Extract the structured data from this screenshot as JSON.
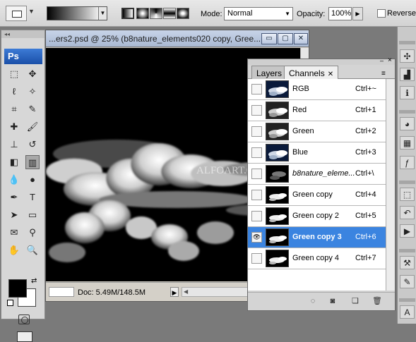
{
  "options_bar": {
    "mode_label": "Mode:",
    "mode_value": "Normal",
    "opacity_label": "Opacity:",
    "opacity_value": "100%",
    "reverse_label": "Reverse",
    "reverse_checked": false
  },
  "toolbox": {
    "logo": "Ps",
    "tools": [
      {
        "name": "marquee-tool-icon",
        "glyph": "⬚"
      },
      {
        "name": "move-tool-icon",
        "glyph": "✥"
      },
      {
        "name": "lasso-tool-icon",
        "glyph": "ℓ"
      },
      {
        "name": "magic-wand-tool-icon",
        "glyph": "✧"
      },
      {
        "name": "crop-tool-icon",
        "glyph": "⌗"
      },
      {
        "name": "slice-tool-icon",
        "glyph": "✎"
      },
      {
        "name": "healing-brush-tool-icon",
        "glyph": "✚"
      },
      {
        "name": "brush-tool-icon",
        "glyph": "🖌"
      },
      {
        "name": "clone-stamp-tool-icon",
        "glyph": "⊥"
      },
      {
        "name": "history-brush-tool-icon",
        "glyph": "↺"
      },
      {
        "name": "eraser-tool-icon",
        "glyph": "◧"
      },
      {
        "name": "gradient-tool-icon",
        "glyph": "▥"
      },
      {
        "name": "blur-tool-icon",
        "glyph": "💧"
      },
      {
        "name": "dodge-tool-icon",
        "glyph": "●"
      },
      {
        "name": "pen-tool-icon",
        "glyph": "✒"
      },
      {
        "name": "type-tool-icon",
        "glyph": "T"
      },
      {
        "name": "path-selection-tool-icon",
        "glyph": "➤"
      },
      {
        "name": "shape-tool-icon",
        "glyph": "▭"
      },
      {
        "name": "notes-tool-icon",
        "glyph": "✉"
      },
      {
        "name": "eyedropper-tool-icon",
        "glyph": "⚲"
      },
      {
        "name": "hand-tool-icon",
        "glyph": "✋"
      },
      {
        "name": "zoom-tool-icon",
        "glyph": "🔍"
      }
    ],
    "selected_tool": "gradient-tool-icon",
    "foreground_color": "#000000",
    "background_color": "#ffffff"
  },
  "document": {
    "title": "...ers2.psd @ 25% (b8nature_elements020 copy, Gree...",
    "watermark": "ALFOART.COM",
    "status": "Doc: 5.49M/148.5M"
  },
  "channels_panel": {
    "tabs": [
      {
        "label": "Layers",
        "active": false
      },
      {
        "label": "Channels",
        "active": true
      }
    ],
    "channels": [
      {
        "name": "RGB",
        "shortcut": "Ctrl+~",
        "visible": false,
        "selected": false,
        "italic": false,
        "thumb": "color"
      },
      {
        "name": "Red",
        "shortcut": "Ctrl+1",
        "visible": false,
        "selected": false,
        "italic": false,
        "thumb": "gray"
      },
      {
        "name": "Green",
        "shortcut": "Ctrl+2",
        "visible": false,
        "selected": false,
        "italic": false,
        "thumb": "gray"
      },
      {
        "name": "Blue",
        "shortcut": "Ctrl+3",
        "visible": false,
        "selected": false,
        "italic": false,
        "thumb": "color"
      },
      {
        "name": "b8nature_eleme...",
        "shortcut": "Ctrl+\\",
        "visible": false,
        "selected": false,
        "italic": true,
        "thumb": "mask"
      },
      {
        "name": "Green copy",
        "shortcut": "Ctrl+4",
        "visible": false,
        "selected": false,
        "italic": false,
        "thumb": "dark"
      },
      {
        "name": "Green copy 2",
        "shortcut": "Ctrl+5",
        "visible": false,
        "selected": false,
        "italic": false,
        "thumb": "dark"
      },
      {
        "name": "Green copy 3",
        "shortcut": "Ctrl+6",
        "visible": true,
        "selected": true,
        "italic": false,
        "thumb": "dark"
      },
      {
        "name": "Green copy 4",
        "shortcut": "Ctrl+7",
        "visible": false,
        "selected": false,
        "italic": false,
        "thumb": "dark"
      }
    ],
    "footer_icons": [
      "load-selection-icon",
      "save-selection-icon",
      "new-channel-icon",
      "delete-channel-icon"
    ]
  },
  "right_dock": {
    "icons": [
      "navigator-icon",
      "histogram-icon",
      "info-icon",
      "color-icon",
      "swatches-icon",
      "styles-icon",
      "paths-icon",
      "history-icon",
      "actions-icon",
      "tool-presets-icon",
      "brushes-icon",
      "character-icon"
    ]
  },
  "colors": {
    "selection": "#3b84e0",
    "panel_bg": "#d4d4d4",
    "workspace": "#7a7a7a"
  }
}
